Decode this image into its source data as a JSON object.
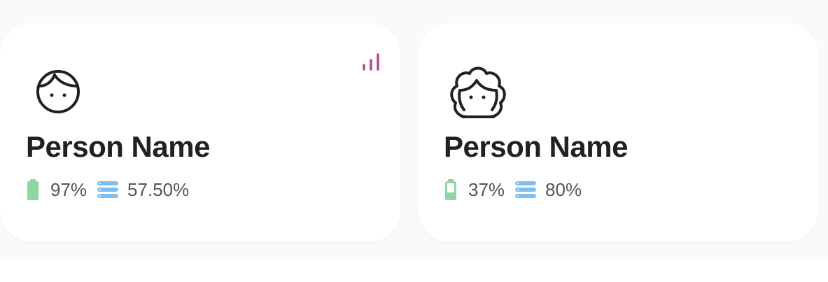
{
  "colors": {
    "battery": "#8fd6a3",
    "storage": "#7fbef2",
    "signal": "#b5488f",
    "icon_stroke": "#212121"
  },
  "people": [
    {
      "avatar_icon": "boy-face-icon",
      "name": "Person Name",
      "battery": "97%",
      "battery_level": 0.97,
      "storage": "57.50%",
      "signal_icon": "signal-bars-icon"
    },
    {
      "avatar_icon": "girl-face-icon",
      "name": "Person Name",
      "battery": "37%",
      "battery_level": 0.37,
      "storage": "80%"
    }
  ]
}
